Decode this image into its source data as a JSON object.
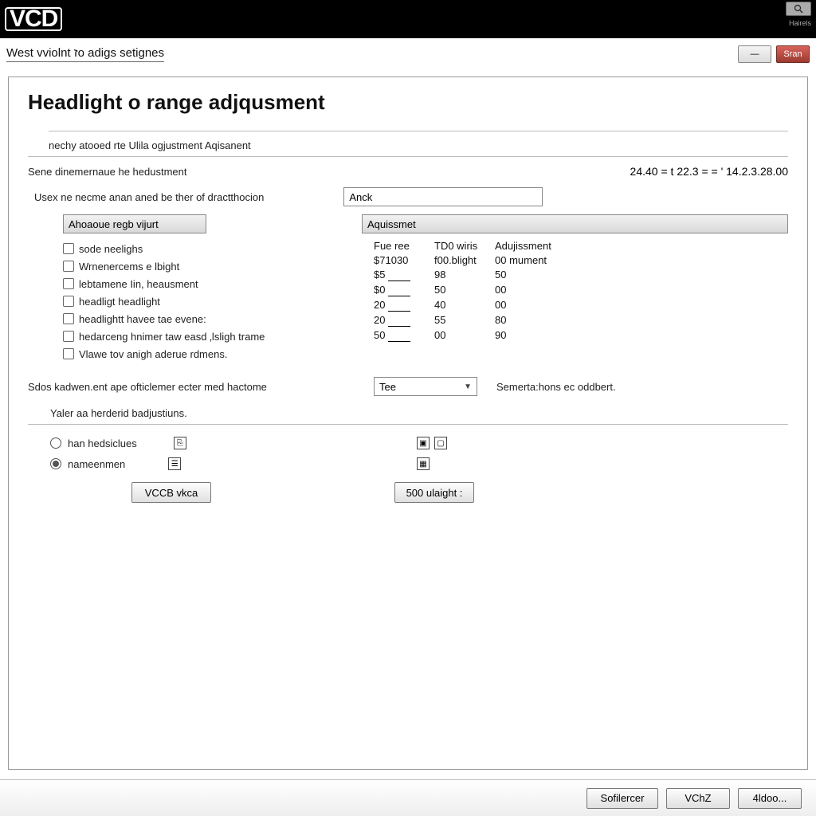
{
  "titlebar": {
    "logo": "VCD",
    "topright_tooltip": "Hairels"
  },
  "subhead": {
    "text": "West vviolnt זo adigs setignes",
    "min": "—",
    "close": "Sran"
  },
  "heading": "Headlight o range adjqusment",
  "group_label": "nechy atooed rte Ulila ogjustment Aqisanent",
  "measure_row": {
    "label": "Sene dinemernaue he hedustment",
    "code": "24.40 = t 22.3 = = ' 14.2.3.28.00"
  },
  "user_label": "Usex ne necme anan aned be ther of dractthocion",
  "anck_value": "Anck",
  "left_header": "Ahoaoue regb vijurt",
  "right_header": "Aquissmet",
  "checkboxes": [
    "sode neelighs",
    "Wrnenercems e lbight",
    "lebtamene Iin, heausment",
    "headligt headlight",
    "headlightt havee tae evene:",
    "hedarceng hnimer taw easd ‚lsligh trame",
    "Vlawe tov anigh aderue rdmens."
  ],
  "table": {
    "headers": [
      "Fue ree",
      "TD0 wiris",
      "Adujissment"
    ],
    "rows": [
      [
        "$71030",
        "f00.blight",
        "00 mument"
      ],
      [
        "$5",
        "98",
        "50"
      ],
      [
        "$0",
        "50",
        "00"
      ],
      [
        "20",
        "40",
        "00"
      ],
      [
        "20",
        "55",
        "80"
      ],
      [
        "50",
        "00",
        "90"
      ]
    ]
  },
  "select_row": {
    "label": "Sdos kadwen.ent ape ofticlemer ecter med hactome",
    "value": "Tee",
    "suffix": "Semerta:hons ec oddbert."
  },
  "section_label": "Yaler aa herderid badjustiuns.",
  "radio1": "han hedsiclues",
  "radio2": "nameenmen",
  "btn_left": "VCCB vkca",
  "btn_right": "500 ulaight :",
  "footer": {
    "b1": "Sofilercer",
    "b2": "VChZ",
    "b3": "4ldoo..."
  }
}
